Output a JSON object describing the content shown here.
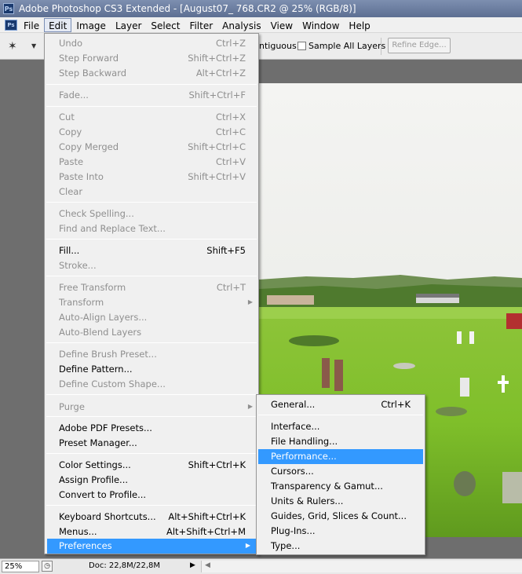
{
  "window": {
    "title": "Adobe Photoshop CS3 Extended - [August07_ 768.CR2 @ 25% (RGB/8)]",
    "logo_text": "Ps"
  },
  "menubar": {
    "doc_icon_text": "Ps",
    "items": [
      "File",
      "Edit",
      "Image",
      "Layer",
      "Select",
      "Filter",
      "Analysis",
      "View",
      "Window",
      "Help"
    ]
  },
  "options": {
    "contiguous_label": "ntiguous",
    "sample_all_layers_label": "Sample All Layers",
    "refine_edge_label": "Refine Edge..."
  },
  "edit_menu": {
    "items": [
      {
        "label": "Undo",
        "shortcut": "Ctrl+Z"
      },
      {
        "label": "Step Forward",
        "shortcut": "Shift+Ctrl+Z"
      },
      {
        "label": "Step Backward",
        "shortcut": "Alt+Ctrl+Z"
      },
      {
        "label": "Fade...",
        "shortcut": "Shift+Ctrl+F"
      },
      {
        "label": "Cut",
        "shortcut": "Ctrl+X"
      },
      {
        "label": "Copy",
        "shortcut": "Ctrl+C"
      },
      {
        "label": "Copy Merged",
        "shortcut": "Shift+Ctrl+C"
      },
      {
        "label": "Paste",
        "shortcut": "Ctrl+V"
      },
      {
        "label": "Paste Into",
        "shortcut": "Shift+Ctrl+V"
      },
      {
        "label": "Clear",
        "shortcut": ""
      },
      {
        "label": "Check Spelling...",
        "shortcut": ""
      },
      {
        "label": "Find and Replace Text...",
        "shortcut": ""
      },
      {
        "label": "Fill...",
        "shortcut": "Shift+F5"
      },
      {
        "label": "Stroke...",
        "shortcut": ""
      },
      {
        "label": "Free Transform",
        "shortcut": "Ctrl+T"
      },
      {
        "label": "Transform",
        "shortcut": ""
      },
      {
        "label": "Auto-Align Layers...",
        "shortcut": ""
      },
      {
        "label": "Auto-Blend Layers",
        "shortcut": ""
      },
      {
        "label": "Define Brush Preset...",
        "shortcut": ""
      },
      {
        "label": "Define Pattern...",
        "shortcut": ""
      },
      {
        "label": "Define Custom Shape...",
        "shortcut": ""
      },
      {
        "label": "Purge",
        "shortcut": ""
      },
      {
        "label": "Adobe PDF Presets...",
        "shortcut": ""
      },
      {
        "label": "Preset Manager...",
        "shortcut": ""
      },
      {
        "label": "Color Settings...",
        "shortcut": "Shift+Ctrl+K"
      },
      {
        "label": "Assign Profile...",
        "shortcut": ""
      },
      {
        "label": "Convert to Profile...",
        "shortcut": ""
      },
      {
        "label": "Keyboard Shortcuts...",
        "shortcut": "Alt+Shift+Ctrl+K"
      },
      {
        "label": "Menus...",
        "shortcut": "Alt+Shift+Ctrl+M"
      },
      {
        "label": "Preferences",
        "shortcut": ""
      }
    ]
  },
  "preferences_menu": {
    "items": [
      {
        "label": "General...",
        "shortcut": "Ctrl+K"
      },
      {
        "label": "Interface...",
        "shortcut": ""
      },
      {
        "label": "File Handling...",
        "shortcut": ""
      },
      {
        "label": "Performance...",
        "shortcut": ""
      },
      {
        "label": "Cursors...",
        "shortcut": ""
      },
      {
        "label": "Transparency & Gamut...",
        "shortcut": ""
      },
      {
        "label": "Units & Rulers...",
        "shortcut": ""
      },
      {
        "label": "Guides, Grid, Slices & Count...",
        "shortcut": ""
      },
      {
        "label": "Plug-Ins...",
        "shortcut": ""
      },
      {
        "label": "Type...",
        "shortcut": ""
      }
    ]
  },
  "status": {
    "zoom": "25%",
    "doc_size": "Doc: 22,8M/22,8M"
  },
  "colors": {
    "highlight": "#3399ff",
    "menu_bg": "#f0f0f0",
    "disabled_text": "#8f8f8f"
  }
}
